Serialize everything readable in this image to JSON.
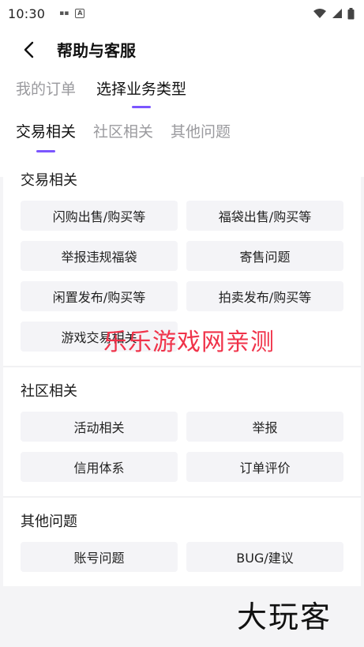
{
  "status_bar": {
    "time": "10:30"
  },
  "header": {
    "title": "帮助与客服",
    "tabs": [
      {
        "label": "我的订单",
        "active": false
      },
      {
        "label": "选择业务类型",
        "active": true
      }
    ],
    "sub_tabs": [
      {
        "label": "交易相关",
        "active": true
      },
      {
        "label": "社区相关",
        "active": false
      },
      {
        "label": "其他问题",
        "active": false
      }
    ],
    "accent_color": "#7b56ff"
  },
  "sections": [
    {
      "title": "交易相关",
      "items": [
        "闪购出售/购买等",
        "福袋出售/购买等",
        "举报违规福袋",
        "寄售问题",
        "闲置发布/购买等",
        "拍卖发布/购买等",
        "游戏交易相关"
      ]
    },
    {
      "title": "社区相关",
      "items": [
        "活动相关",
        "举报",
        "信用体系",
        "订单评价"
      ]
    },
    {
      "title": "其他问题",
      "items": [
        "账号问题",
        "BUG/建议"
      ]
    }
  ],
  "watermark": "乐乐游戏网亲测",
  "logo_text": "大玩客",
  "icons": {
    "back": "back-arrow-icon",
    "wifi": "wifi-icon",
    "signal": "signal-icon",
    "battery": "battery-icon"
  }
}
